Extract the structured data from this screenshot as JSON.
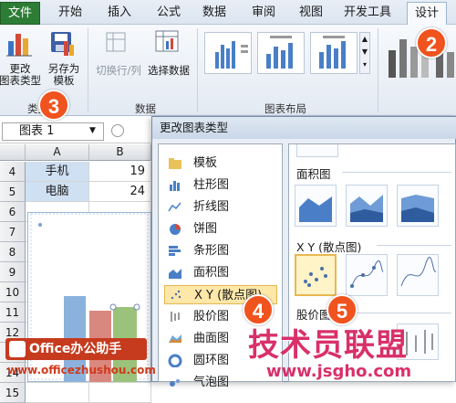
{
  "ribbon_tabs": [
    "文件",
    "开始",
    "插入",
    "公式",
    "数据",
    "审阅",
    "视图",
    "开发工具",
    "设计"
  ],
  "ribbon": {
    "change_chart_type": "更改\n图表类型",
    "save_as_template": "另存为\n模板",
    "group_type": "类型",
    "switch_row_col": "切换行/列",
    "select_data": "选择数据",
    "group_data": "数据",
    "group_layout": "图表布局"
  },
  "namebox": {
    "value": "图表 1"
  },
  "sheet": {
    "columns": [
      "A",
      "B"
    ],
    "rows": [
      {
        "num": "4",
        "a": "手机",
        "b": "19"
      },
      {
        "num": "5",
        "a": "电脑",
        "b": "24"
      },
      {
        "num": "6"
      },
      {
        "num": "7"
      },
      {
        "num": "8"
      },
      {
        "num": "9"
      },
      {
        "num": "10"
      },
      {
        "num": "11"
      },
      {
        "num": "12"
      },
      {
        "num": "13"
      },
      {
        "num": "14"
      },
      {
        "num": "15"
      }
    ]
  },
  "dialog": {
    "title": "更改图表类型",
    "types": [
      "模板",
      "柱形图",
      "折线图",
      "饼图",
      "条形图",
      "面积图",
      "X Y (散点图)",
      "股价图",
      "曲面图",
      "圆环图",
      "气泡图"
    ],
    "selected_type": "X Y (散点图)",
    "sections": {
      "area": "面积图",
      "scatter": "X Y (散点图)",
      "stock": "股价图"
    }
  },
  "annotations": [
    "2",
    "3",
    "4",
    "5"
  ],
  "watermarks": {
    "brand": "Office办公助手",
    "site": "www.officezhushou.com",
    "cn_brand": "技术员联盟",
    "cn_site": "www.jsgho.com"
  },
  "colors": {
    "file_tab": "#2c7c35",
    "selection": "#fde7a9",
    "badge": "#f0531e"
  }
}
